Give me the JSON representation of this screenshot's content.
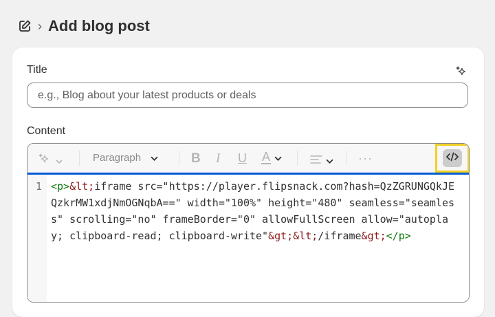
{
  "header": {
    "title": "Add blog post"
  },
  "form": {
    "title_label": "Title",
    "title_placeholder": "e.g., Blog about your latest products or deals",
    "content_label": "Content"
  },
  "toolbar": {
    "paragraph_label": "Paragraph",
    "bold_label": "B",
    "italic_label": "I",
    "underline_label": "U",
    "color_label": "A",
    "more_label": "···"
  },
  "editor": {
    "line_number": "1",
    "code": {
      "p_open": "<p>",
      "lt1": "&lt;",
      "text1": "iframe src=\"https://player.flipsnack.com?hash=QzZGRUNGQkJEQzkrMW1xdjNmOGNqbA==\" width=\"100%\" height=\"480\" seamless=\"seamless\" scrolling=\"no\" frameBorder=\"0\" allowFullScreen allow=\"autoplay; clipboard-read; clipboard-write\"",
      "gt1": "&gt;",
      "lt2": "&lt;",
      "text2": "/iframe",
      "gt2": "&gt;",
      "p_close": "</p>"
    }
  },
  "colors": {
    "accent": "#005bd3",
    "highlight": "#f2d024"
  }
}
